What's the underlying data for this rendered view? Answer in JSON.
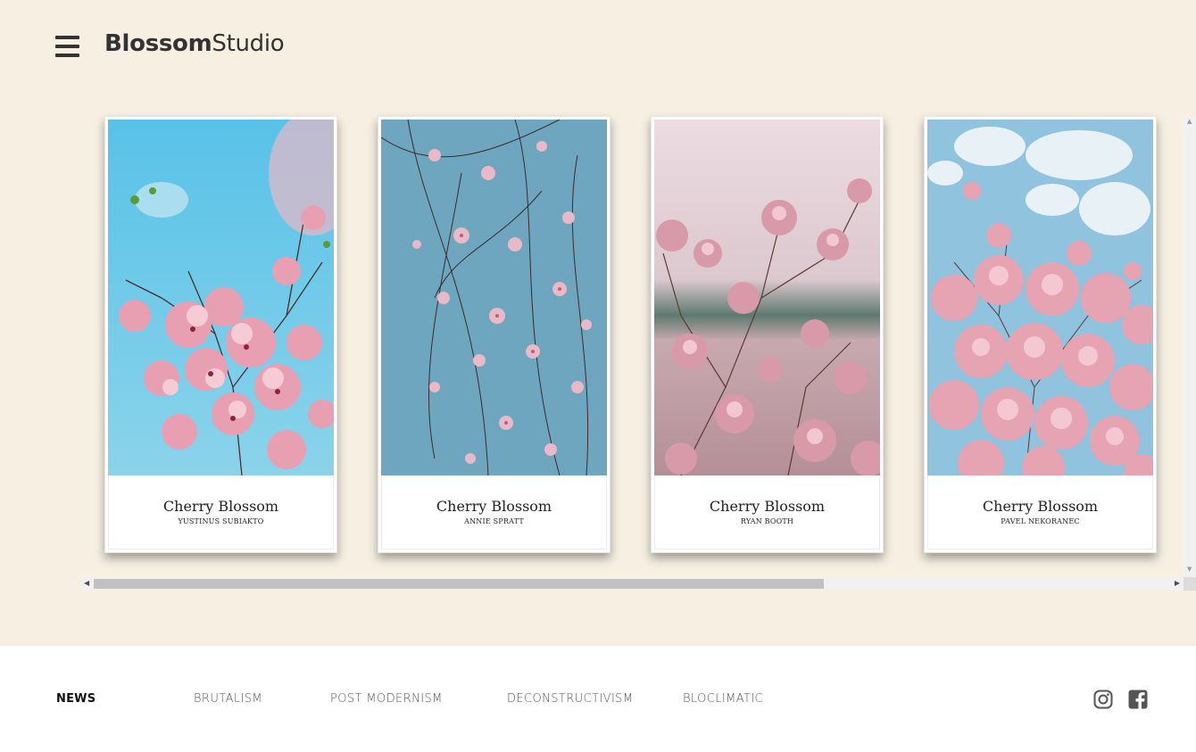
{
  "header": {
    "brand_bold": "Blossom",
    "brand_light": "Studio",
    "menu_icon": "hamburger-menu-icon"
  },
  "gallery": {
    "cards": [
      {
        "title": "Cherry Blossom",
        "author": "YUSTINUS SUBIAKTO"
      },
      {
        "title": "Cherry Blossom",
        "author": "ANNIE SPRATT"
      },
      {
        "title": "Cherry Blossom",
        "author": "RYAN BOOTH"
      },
      {
        "title": "Cherry Blossom",
        "author": "PAVEL NEKORANEC"
      }
    ]
  },
  "footer": {
    "nav": [
      {
        "label": "NEWS",
        "active": true
      },
      {
        "label": "BRUTALISM",
        "active": false
      },
      {
        "label": "POST MODERNISM",
        "active": false
      },
      {
        "label": "DECONSTRUCTIVISM",
        "active": false
      },
      {
        "label": "BLOCLIMATIC",
        "active": false
      }
    ],
    "social": [
      "instagram-icon",
      "facebook-icon"
    ]
  },
  "colors": {
    "background": "#f6efe2",
    "text": "#333333",
    "blossom_pink": "#e8a3b0",
    "sky_blue": "#5cc3e6"
  }
}
